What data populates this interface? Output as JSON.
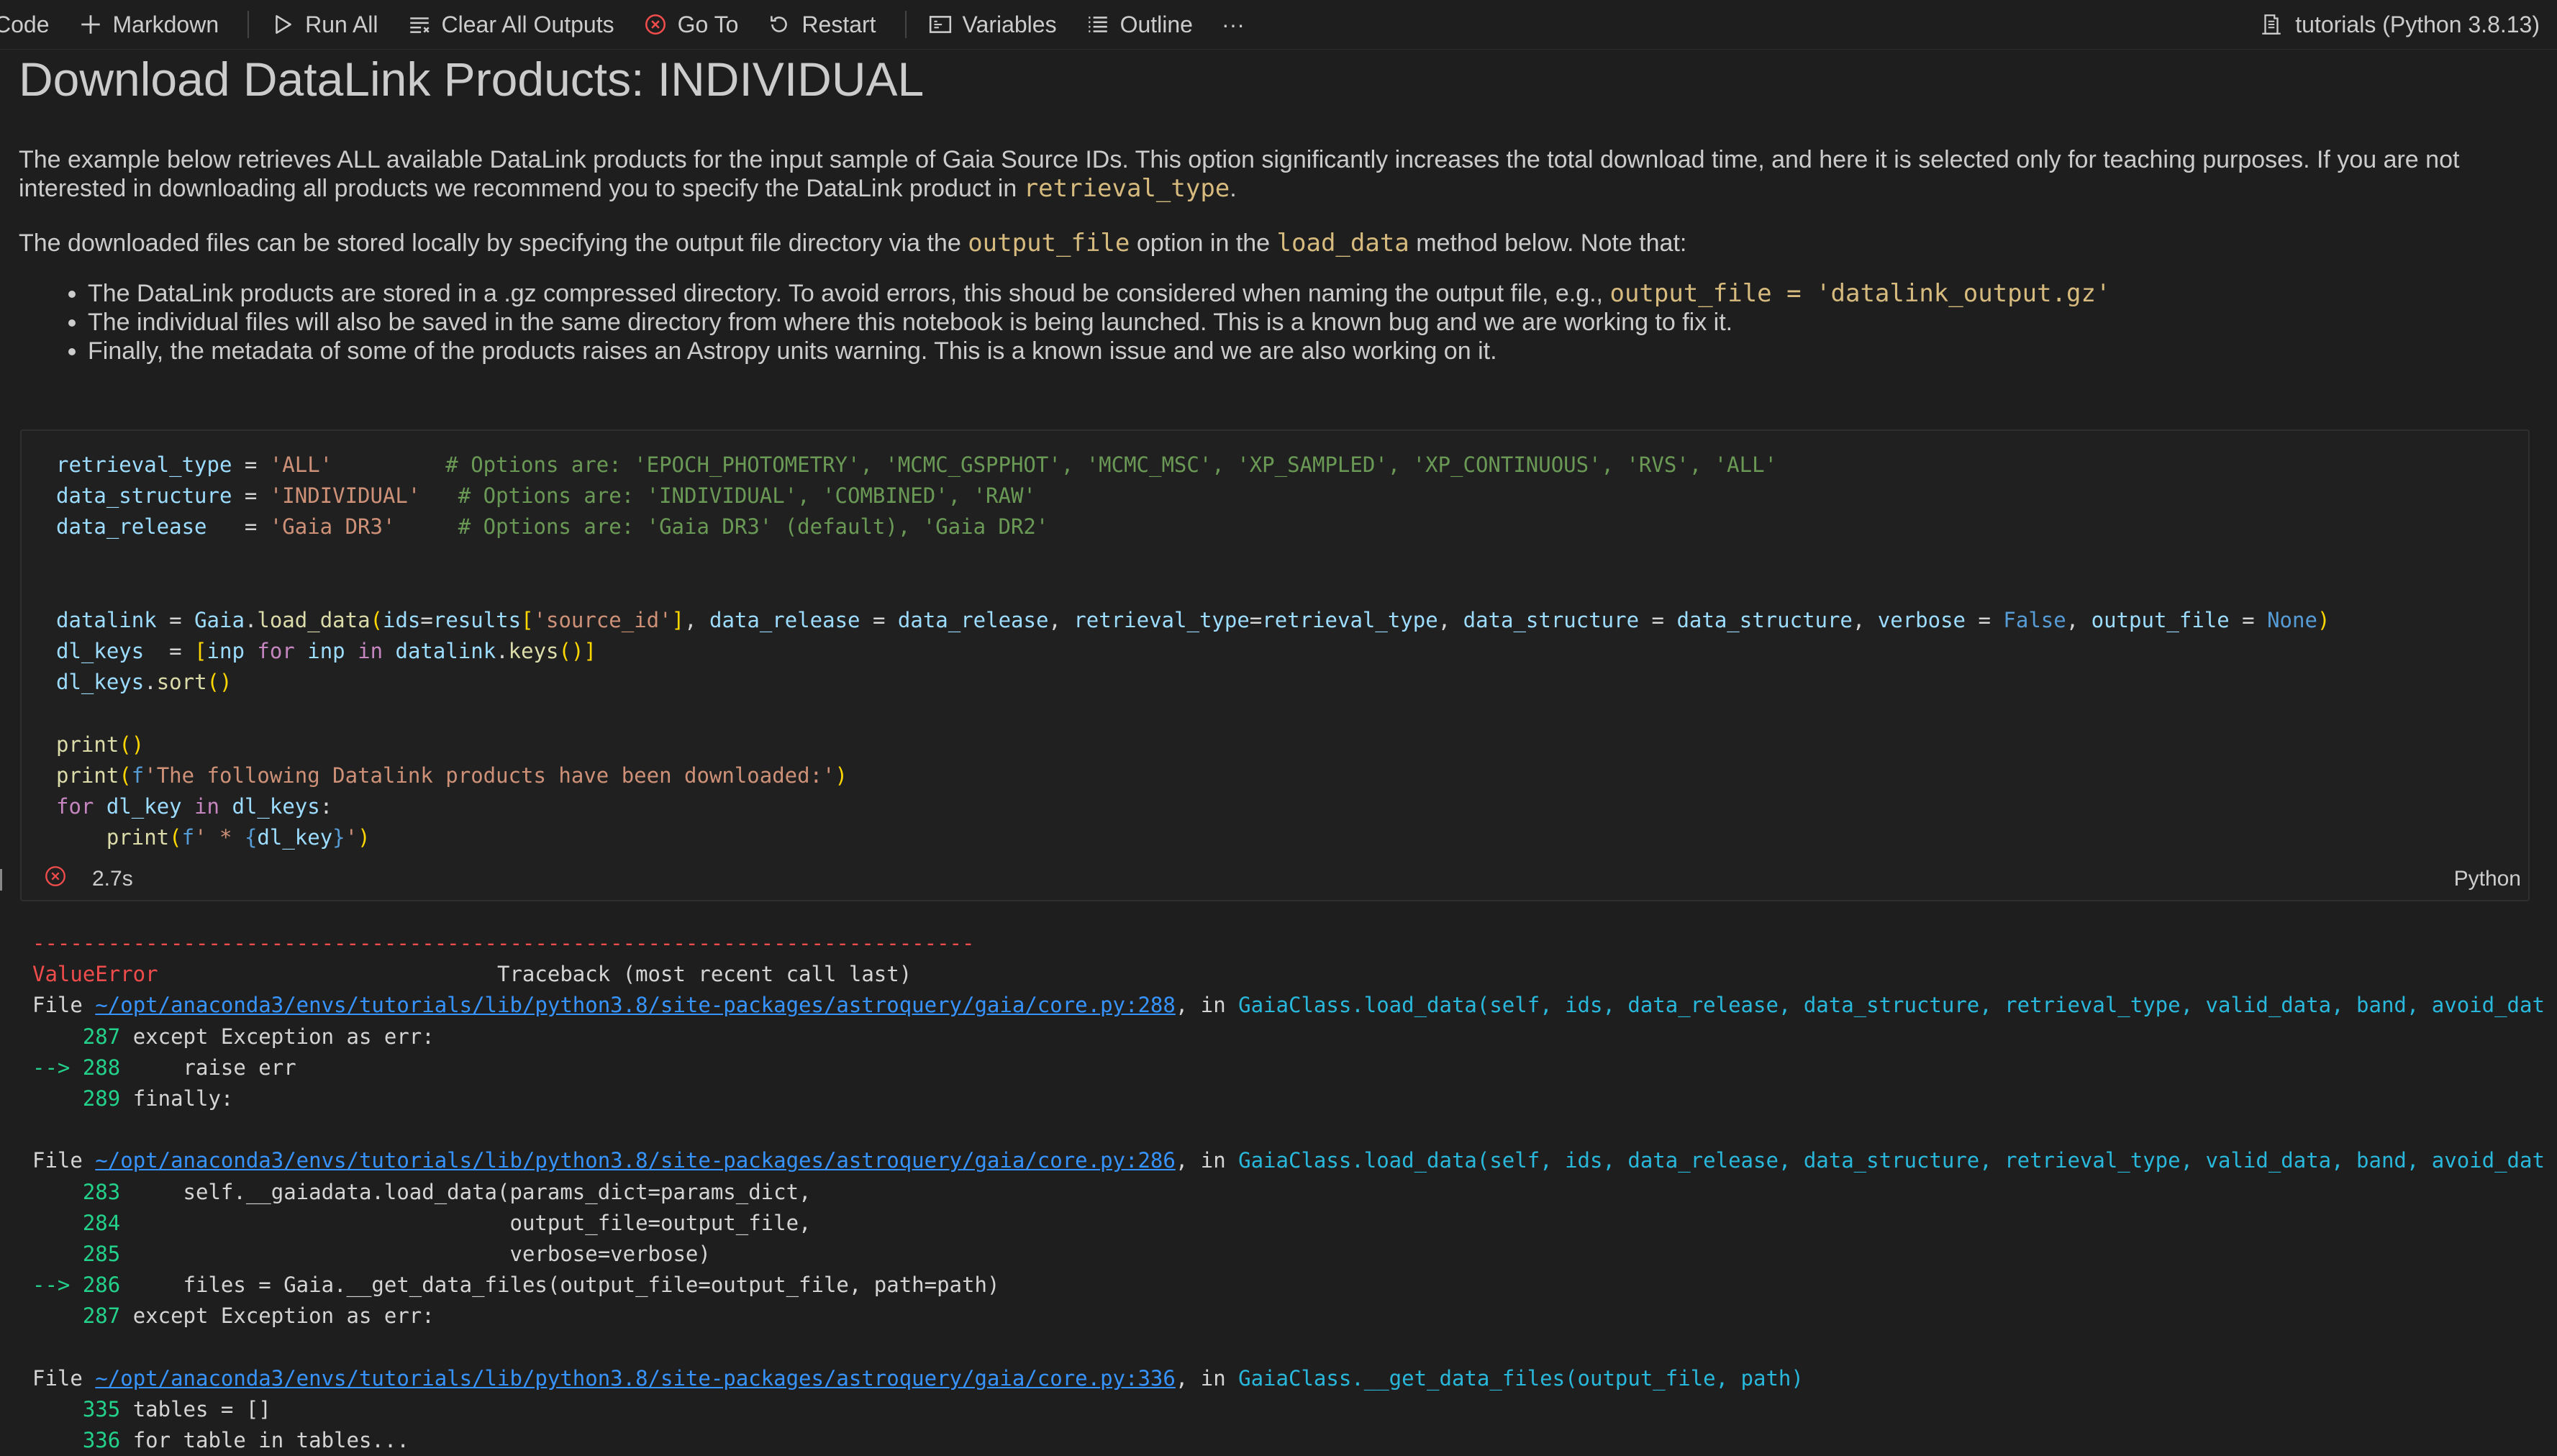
{
  "toolbar": {
    "code_label": "Code",
    "markdown_label": "Markdown",
    "run_all_label": "Run All",
    "clear_label": "Clear All Outputs",
    "goto_label": "Go To",
    "restart_label": "Restart",
    "variables_label": "Variables",
    "outline_label": "Outline",
    "more_label": "···",
    "kernel_label": "tutorials (Python 3.8.13)"
  },
  "markdown": {
    "title": "Download DataLink Products: INDIVIDUAL",
    "p1_a": "The example below retrieves ALL available DataLink products for the input sample of Gaia Source IDs. This option significantly increases the total download time, and here it is selected only for teaching purposes. If you are not interested in downloading all products we recommend you to specify the DataLink product in ",
    "p1_code": "retrieval_type",
    "p1_b": ".",
    "p2_a": "The downloaded files can be stored locally by specifying the output file directory via the ",
    "p2_code1": "output_file",
    "p2_b": " option in the ",
    "p2_code2": "load_data",
    "p2_c": " method below. Note that:",
    "bullet1_a": "The DataLink products are stored in a .gz compressed directory. To avoid errors, this shoud be considered when naming the output file, e.g., ",
    "bullet1_code": "output_file = 'datalink_output.gz'",
    "bullet2": "The individual files will also be saved in the same directory from where this notebook is being launched. This is a known bug and we are working to fix it.",
    "bullet3": "Finally, the metadata of some of the products raises an Astropy units warning. This is a known issue and we are also working on it."
  },
  "cell": {
    "duration": "2.7s",
    "language": "Python",
    "code_lines": [
      "retrieval_type = 'ALL'         # Options are: 'EPOCH_PHOTOMETRY', 'MCMC_GSPPHOT', 'MCMC_MSC', 'XP_SAMPLED', 'XP_CONTINUOUS', 'RVS', 'ALL'",
      "data_structure = 'INDIVIDUAL'   # Options are: 'INDIVIDUAL', 'COMBINED', 'RAW'",
      "data_release   = 'Gaia DR3'     # Options are: 'Gaia DR3' (default), 'Gaia DR2'",
      "",
      "",
      "datalink = Gaia.load_data(ids=results['source_id'], data_release = data_release, retrieval_type=retrieval_type, data_structure = data_structure, verbose = False, output_file = None)",
      "dl_keys  = [inp for inp in datalink.keys()]",
      "dl_keys.sort()",
      "",
      "print()",
      "print(f'The following Datalink products have been downloaded:')",
      "for dl_key in dl_keys:",
      "    print(f' * {dl_key}')"
    ]
  },
  "output": {
    "separator": "---------------------------------------------------------------------------",
    "error_name": "ValueError",
    "traceback_header": "Traceback (most recent call last)",
    "frames": [
      {
        "file_prefix": "File ",
        "path": "~/opt/anaconda3/envs/tutorials/lib/python3.8/site-packages/astroquery/gaia/core.py:288",
        "in_text": ", in ",
        "func": "GaiaClass.load_data",
        "args": "(self, ids, data_release, data_structure, retrieval_type, valid_data, band, avoid_dat",
        "lines": [
          {
            "arrow": "    ",
            "num": "287",
            "text": " except Exception as err:"
          },
          {
            "arrow": "--> ",
            "num": "288",
            "text": "     raise err"
          },
          {
            "arrow": "    ",
            "num": "289",
            "text": " finally:"
          }
        ]
      },
      {
        "file_prefix": "File ",
        "path": "~/opt/anaconda3/envs/tutorials/lib/python3.8/site-packages/astroquery/gaia/core.py:286",
        "in_text": ", in ",
        "func": "GaiaClass.load_data",
        "args": "(self, ids, data_release, data_structure, retrieval_type, valid_data, band, avoid_dat",
        "lines": [
          {
            "arrow": "    ",
            "num": "283",
            "text": "     self.__gaiadata.load_data(params_dict=params_dict,"
          },
          {
            "arrow": "    ",
            "num": "284",
            "text": "                               output_file=output_file,"
          },
          {
            "arrow": "    ",
            "num": "285",
            "text": "                               verbose=verbose)"
          },
          {
            "arrow": "--> ",
            "num": "286",
            "text": "     files = Gaia.__get_data_files(output_file=output_file, path=path)"
          },
          {
            "arrow": "    ",
            "num": "287",
            "text": " except Exception as err:"
          }
        ]
      },
      {
        "file_prefix": "File ",
        "path": "~/opt/anaconda3/envs/tutorials/lib/python3.8/site-packages/astroquery/gaia/core.py:336",
        "in_text": ", in ",
        "func": "GaiaClass.__get_data_files",
        "args": "(output_file, path)",
        "lines": [
          {
            "arrow": "    ",
            "num": "335",
            "text": " tables = []"
          },
          {
            "arrow": "    ",
            "num": "336",
            "text": " for table in tables..."
          }
        ]
      }
    ]
  }
}
